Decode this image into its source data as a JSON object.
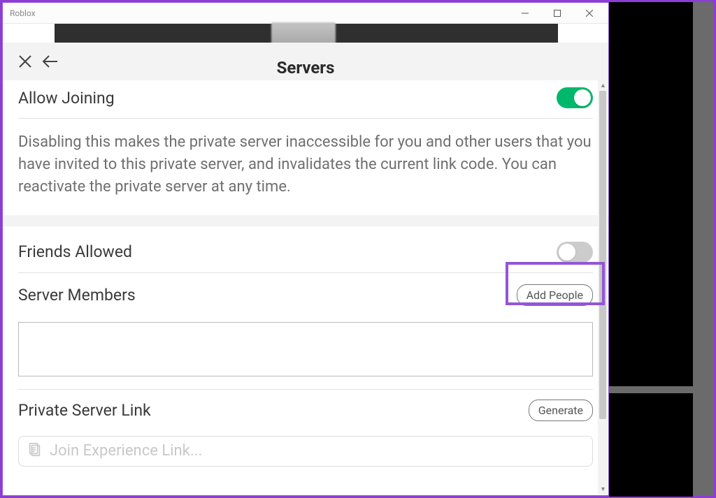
{
  "window": {
    "title": "Roblox"
  },
  "modal": {
    "title": "Servers"
  },
  "allowJoining": {
    "label": "Allow Joining",
    "enabled": true,
    "description": "Disabling this makes the private server inaccessible for you and other users that you have invited to this private server, and invalidates the current link code. You can reactivate the private server at any time."
  },
  "friendsAllowed": {
    "label": "Friends Allowed",
    "enabled": false
  },
  "serverMembers": {
    "label": "Server Members",
    "addButtonLabel": "Add People"
  },
  "privateServerLink": {
    "label": "Private Server Link",
    "generateButtonLabel": "Generate",
    "placeholder": "Join Experience Link..."
  }
}
